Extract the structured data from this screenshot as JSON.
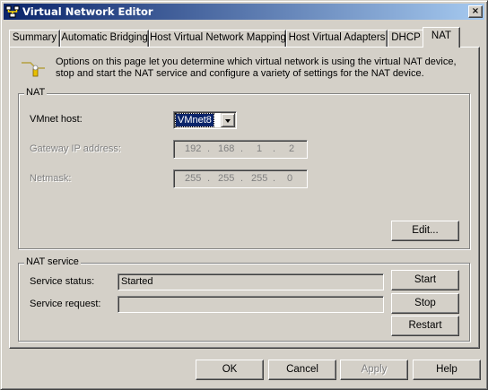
{
  "window": {
    "title": "Virtual Network Editor",
    "close_glyph": "×"
  },
  "tabs": [
    {
      "label": "Summary",
      "active": false
    },
    {
      "label": "Automatic Bridging",
      "active": false
    },
    {
      "label": "Host Virtual Network Mapping",
      "active": false
    },
    {
      "label": "Host Virtual Adapters",
      "active": false
    },
    {
      "label": "DHCP",
      "active": false
    },
    {
      "label": "NAT",
      "active": true
    }
  ],
  "intro": {
    "icon": "network-nat-icon",
    "text": "Options on this page let you determine which virtual network is using the virtual NAT device, stop and start the NAT service and configure a variety of settings for the NAT device."
  },
  "nat_group": {
    "title": "NAT",
    "vmnet_host_label": "VMnet host:",
    "vmnet_host_value": "VMnet8",
    "gateway_label": "Gateway IP address:",
    "gateway_ip": [
      "192",
      "168",
      "1",
      "2"
    ],
    "netmask_label": "Netmask:",
    "netmask": [
      "255",
      "255",
      "255",
      "0"
    ],
    "edit_label": "Edit..."
  },
  "service_group": {
    "title": "NAT service",
    "status_label": "Service status:",
    "status_value": "Started",
    "request_label": "Service request:",
    "request_value": "",
    "start_label": "Start",
    "stop_label": "Stop",
    "restart_label": "Restart"
  },
  "footer": {
    "ok_label": "OK",
    "cancel_label": "Cancel",
    "apply_label": "Apply",
    "help_label": "Help"
  },
  "colors": {
    "face": "#d4d0c8",
    "titlebar_start": "#0a246a",
    "titlebar_end": "#a6caf0",
    "selection": "#0a246a",
    "disabled_text": "#808080"
  }
}
